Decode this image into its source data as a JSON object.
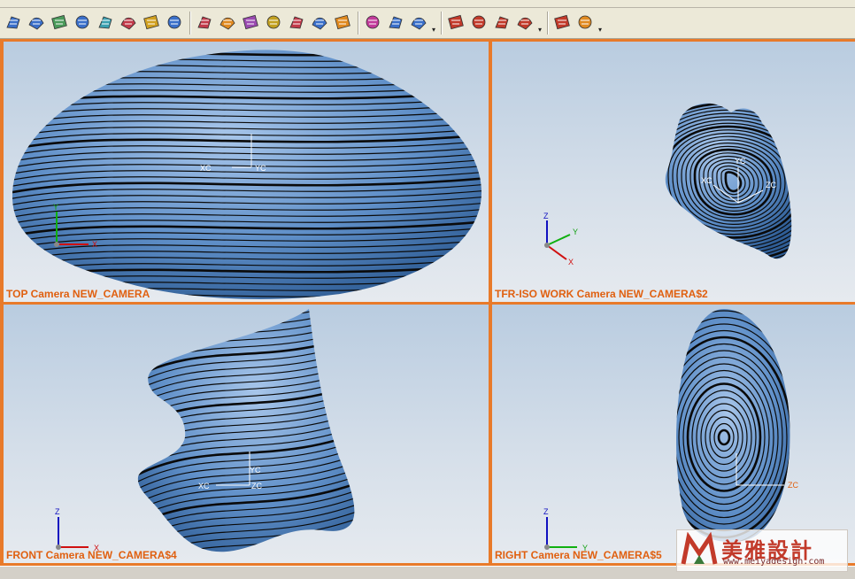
{
  "toolbar": {
    "buttons": [
      {
        "name": "extract-icon",
        "color": "#3a6fc9"
      },
      {
        "name": "rectangle-icon",
        "color": "#3a6fc9"
      },
      {
        "name": "mesh-surface-icon",
        "color": "#4a9a5a"
      },
      {
        "name": "ruled-surface-icon",
        "color": "#3a6fc9"
      },
      {
        "name": "through-curves-icon",
        "color": "#3aa0b0"
      },
      {
        "name": "through-curve-mesh-icon",
        "color": "#c23a4a"
      },
      {
        "name": "swept-icon",
        "color": "#d0a020"
      },
      {
        "name": "section-surface-icon",
        "color": "#3a6fc9"
      },
      {
        "name": "bridge-surface-icon",
        "color": "#c23a4a"
      },
      {
        "name": "n-sided-surface-icon",
        "color": "#e08a20"
      },
      {
        "name": "transition-icon",
        "color": "#9a4ab0"
      },
      {
        "name": "studio-surface-icon",
        "color": "#c2a020"
      },
      {
        "name": "styled-sweep-icon",
        "color": "#c23a4a"
      },
      {
        "name": "law-extension-icon",
        "color": "#3a6fc9"
      },
      {
        "name": "offset-surface-icon",
        "color": "#e08a20"
      },
      {
        "name": "trim-sheet-icon",
        "color": "#c23a9a"
      },
      {
        "name": "sew-icon",
        "color": "#3a6fc9"
      },
      {
        "name": "x-form-icon",
        "color": "#3a6fc9"
      },
      {
        "name": "curve-analysis-icon",
        "color": "#c23a2a"
      },
      {
        "name": "combed-curve-icon",
        "color": "#c23a2a"
      },
      {
        "name": "reflection-analysis-icon",
        "color": "#c23a2a"
      },
      {
        "name": "draft-analysis-icon",
        "color": "#c23a2a"
      },
      {
        "name": "snap-point-icon",
        "color": "#c23a2a"
      },
      {
        "name": "show-point-icon",
        "color": "#e08a20"
      }
    ]
  },
  "viewports": [
    {
      "label": "TOP Camera NEW_CAMERA",
      "axes": {
        "a": "Y",
        "b": "X",
        "c": ""
      }
    },
    {
      "label": "TFR-ISO WORK Camera NEW_CAMERA$2",
      "axes": {
        "a": "Z",
        "b": "Y",
        "c": "X"
      }
    },
    {
      "label": "FRONT Camera NEW_CAMERA$4",
      "axes": {
        "a": "Z",
        "b": "X",
        "c": ""
      }
    },
    {
      "label": "RIGHT Camera NEW_CAMERA$5",
      "axes": {
        "a": "Z",
        "b": "Y",
        "c": ""
      }
    }
  ],
  "wcs": {
    "top": {
      "x": "XC",
      "y": "YC"
    },
    "iso": {
      "x": "XC",
      "y": "YC",
      "z": "ZC"
    },
    "front": {
      "x": "XC",
      "y": "YC",
      "z": "ZC"
    },
    "right": {
      "z": "ZC"
    }
  },
  "watermark": {
    "brand": "美雅設計",
    "url": "www.meiyadesign.com"
  }
}
